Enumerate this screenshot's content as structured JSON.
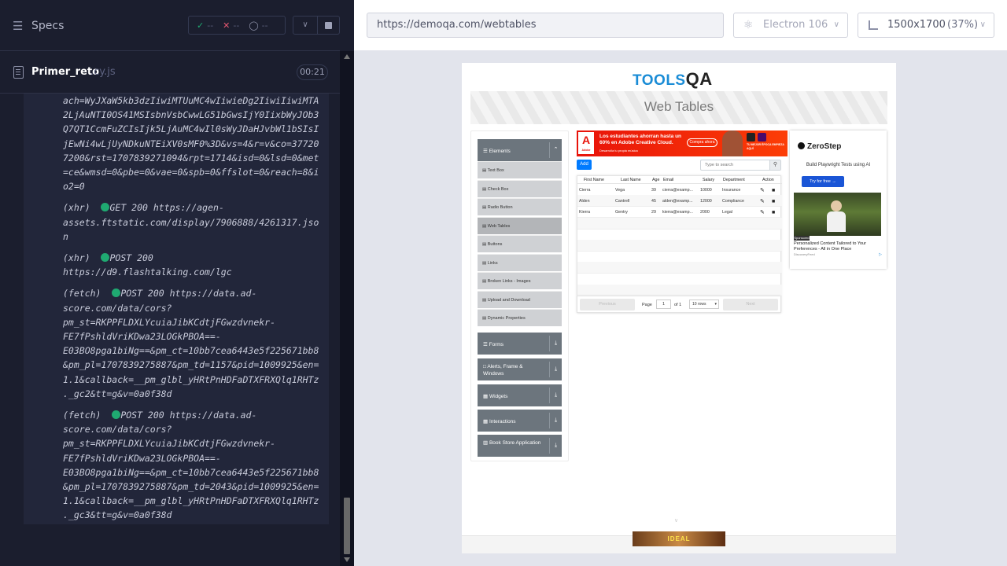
{
  "reporter": {
    "specs_title": "Specs",
    "stats": {
      "passed": "--",
      "failed": "--",
      "pending": "--"
    },
    "spec_file": "Primer_reto",
    "spec_ext": ".cy.js",
    "duration": "00:21",
    "log_lines": [
      "ach=WyJXaW5kb3dzIiwiMTUuMC4wIiwieDg2IiwiIiwiMTA",
      "2LjAuNTI0OS41MSIsbnVsbCwwLG51bGwsIjY0IixbWyJOb3",
      "Q7QT1CcmFuZCIsIjk5LjAuMC4wIl0sWyJDaHJvbWl1bSIsI",
      "jEwNi4wLjUyNDkuNTEiXV0sMF0%3D&vs=4&r=v&co=37720",
      "7200&rst=1707839271094&rpt=1714&isd=0&lsd=0&met",
      "=ce&wmsd=0&pbe=0&vae=0&spb=0&ffslot=0&reach=8&i",
      "o2=0",
      "",
      "(xhr)  ●GET 200 https://agen-",
      "assets.ftstatic.com/display/7906888/4261317.jso",
      "n",
      "",
      "(xhr)  ●POST 200",
      "https://d9.flashtalking.com/lgc",
      "",
      "(fetch)  ●POST 200 https://data.ad-",
      "score.com/data/cors?",
      "pm_st=RKPPFLDXLYcuiaJibKCdtjFGwzdvnekr-",
      "FE7fPshldVriKDwa23LOGkPBOA==-",
      "E03BO8pga1biNg==&pm_ct=10bb7cea6443e5f225671bb8",
      "&pm_pl=1707839275887&pm_td=1157&pid=1009925&en=",
      "1.1&callback=__pm_glbl_yHRtPnHDFaDTXFRXQlq1RHTz",
      "._gc2&tt=g&v=0a0f38d",
      "",
      "(fetch)  ●POST 200 https://data.ad-",
      "score.com/data/cors?",
      "pm_st=RKPPFLDXLYcuiaJibKCdtjFGwzdvnekr-",
      "FE7fPshldVriKDwa23LOGkPBOA==-",
      "E03BO8pga1biNg==&pm_ct=10bb7cea6443e5f225671bb8",
      "&pm_pl=1707839275887&pm_td=2043&pid=1009925&en=",
      "1.1&callback=__pm_glbl_yHRtPnHDFaDTXFRXQlq1RHTz",
      "._gc3&tt=g&v=0a0f38d"
    ]
  },
  "browser_bar": {
    "url": "https://demoqa.com/webtables",
    "browser": "Electron 106",
    "viewport": "1500x1700",
    "zoom": "(37%)"
  },
  "aut": {
    "logo": "TOOLS",
    "logo_suffix": "QA",
    "page_title": "Web Tables",
    "groups": [
      {
        "label": "Elements",
        "glyph": "☰"
      },
      {
        "label": "Forms",
        "glyph": "☰"
      },
      {
        "label": "Alerts, Frame & Windows",
        "glyph": "□"
      },
      {
        "label": "Widgets",
        "glyph": "▦"
      },
      {
        "label": "Interactions",
        "glyph": "▦"
      },
      {
        "label": "Book Store Application",
        "glyph": "▥"
      }
    ],
    "element_items": [
      "Text Box",
      "Check Box",
      "Radio Button",
      "Web Tables",
      "Buttons",
      "Links",
      "Broken Links - Images",
      "Upload and Download",
      "Dynamic Properties"
    ],
    "add_label": "Add",
    "search_placeholder": "Type to search",
    "columns": [
      "First Name",
      "Last Name",
      "Age",
      "Email",
      "Salary",
      "Department",
      "Action"
    ],
    "rows": [
      [
        "Cierra",
        "Vega",
        "39",
        "cierra@examp...",
        "10000",
        "Insurance"
      ],
      [
        "Alden",
        "Cantrell",
        "45",
        "alden@examp...",
        "12000",
        "Compliance"
      ],
      [
        "Kierra",
        "Gentry",
        "29",
        "kierra@examp...",
        "2000",
        "Legal"
      ]
    ],
    "pager": {
      "previous": "Previous",
      "page": "Page",
      "page_value": "1",
      "of": "of 1",
      "rows": "10 rows",
      "next": "Next"
    },
    "ad_top": {
      "logo": "A",
      "brand": "Adobe",
      "text": "Los estudiantes ahorran hasta un 60% en Adobe Creative Cloud.",
      "subtext": "Desarrolla tu propia música",
      "button": "Compra ahora",
      "side": "TU MEJOR ÉPOCA EMPIEZA AQUÍ"
    },
    "ad_side": {
      "brand": "ZeroStep",
      "sub": "Build Playwright Tests using AI",
      "button": "Try for free →",
      "badge": "Sponsored",
      "caption": "Personalized Content Tailored to Your Preferences - All in One Place",
      "source": "DiscoveryFeed"
    },
    "ad_bottom": "IDEAL"
  }
}
